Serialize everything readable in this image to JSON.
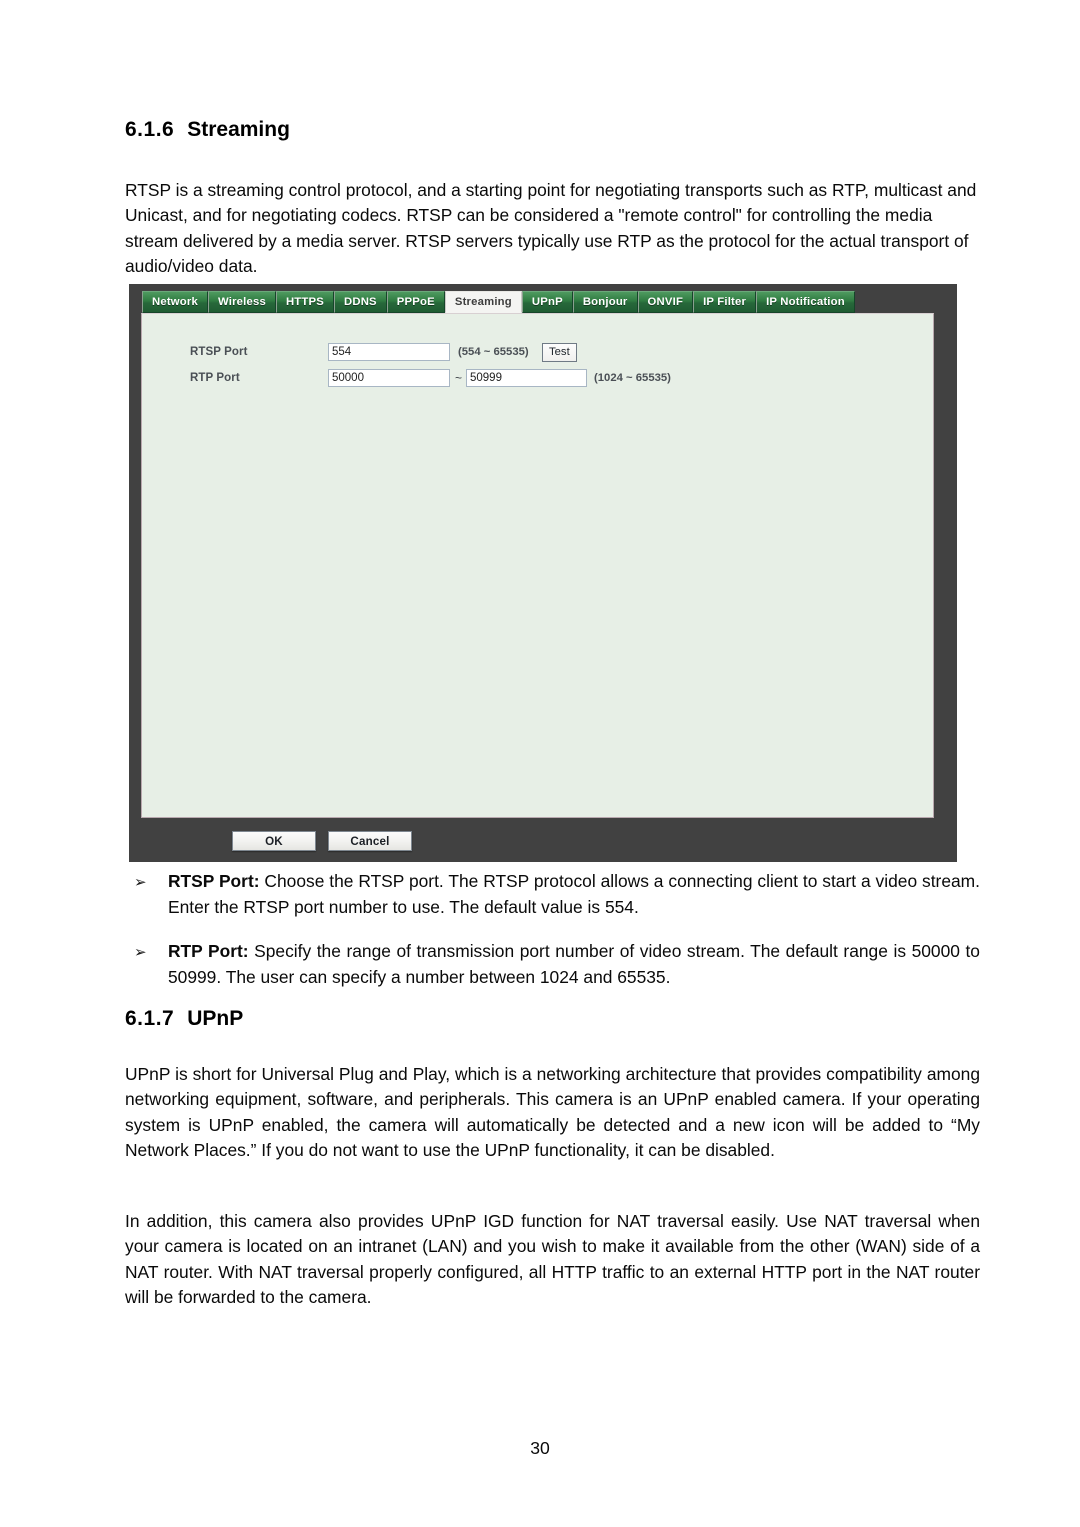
{
  "document": {
    "page_number": "30",
    "sections": [
      {
        "number": "6.1.6",
        "title": "Streaming",
        "intro": "RTSP is a streaming control protocol, and a starting point for negotiating transports such as RTP, multicast and Unicast, and for negotiating codecs. RTSP can be considered a \"remote control\" for controlling the media stream delivered by a media server. RTSP servers typically use RTP as the protocol for the actual transport of audio/video data."
      },
      {
        "number": "6.1.7",
        "title": "UPnP",
        "para1": "UPnP is short for Universal Plug and Play, which is a networking architecture that provides compatibility among networking equipment, software, and peripherals. This camera is an UPnP enabled camera. If your operating system is UPnP enabled, the camera will automatically be detected and a new icon will be added to “My Network Places.” If you do not want to use the UPnP functionality, it can be disabled.",
        "para2": "In addition, this camera also provides UPnP IGD function for NAT traversal easily. Use NAT traversal when your camera is located on an intranet (LAN) and you wish to make it available from the other (WAN) side of a NAT router. With NAT traversal properly configured, all HTTP traffic to an external HTTP port in the NAT router will be forwarded to the camera."
      }
    ],
    "bullets": [
      {
        "marker": "➢",
        "term": "RTSP Port:",
        "text": " Choose the RTSP port. The RTSP protocol allows a connecting client to start a video stream. Enter the RTSP port number to use. The default value is 554."
      },
      {
        "marker": "➢",
        "term": "RTP Port:",
        "text": " Specify the range of transmission port number of video stream. The default range is 50000 to 50999. The user can specify a number between 1024 and 65535."
      }
    ]
  },
  "screenshot": {
    "tabs": [
      {
        "label": "Network",
        "active": false
      },
      {
        "label": "Wireless",
        "active": false
      },
      {
        "label": "HTTPS",
        "active": false
      },
      {
        "label": "DDNS",
        "active": false
      },
      {
        "label": "PPPoE",
        "active": false
      },
      {
        "label": "Streaming",
        "active": true
      },
      {
        "label": "UPnP",
        "active": false
      },
      {
        "label": "Bonjour",
        "active": false
      },
      {
        "label": "ONVIF",
        "active": false
      },
      {
        "label": "IP Filter",
        "active": false
      },
      {
        "label": "IP Notification",
        "active": false
      }
    ],
    "form": {
      "rtsp_port": {
        "label": "RTSP Port",
        "value": "554",
        "range_note": "(554 ~ 65535)",
        "test_button": "Test"
      },
      "rtp_port": {
        "label": "RTP Port",
        "value_start": "50000",
        "separator": "~",
        "value_end": "50999",
        "range_note": "(1024 ~ 65535)"
      }
    },
    "footer": {
      "ok_label": "OK",
      "cancel_label": "Cancel"
    },
    "colors": {
      "tab_green": "#2f7b41",
      "tab_active_bg": "#f4f4f2",
      "panel_bg": "#e7efe6",
      "frame_dark": "#414141"
    }
  }
}
